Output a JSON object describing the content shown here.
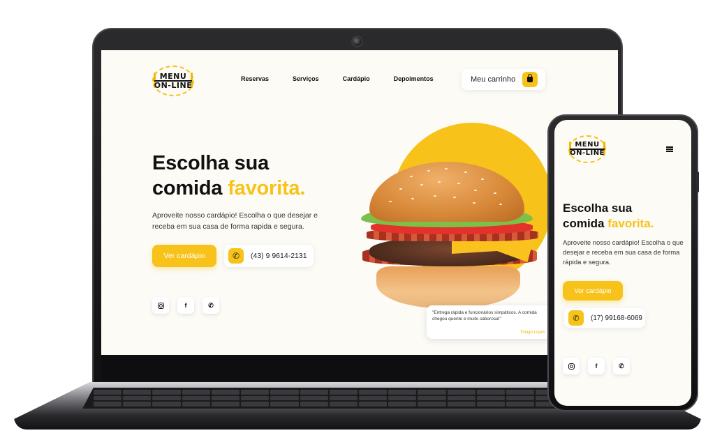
{
  "brand": {
    "line1": "MENU",
    "line2": "ON-LINE",
    "accent_color": "#f7c21a"
  },
  "desktop": {
    "nav": [
      "Reservas",
      "Serviços",
      "Cardápio",
      "Depoimentos"
    ],
    "cart_label": "Meu carrinho",
    "hero_title_line1": "Escolha sua",
    "hero_title_line2_plain": "comida",
    "hero_title_line2_accent": "favorita.",
    "hero_text": "Aproveite nosso cardápio! Escolha o que desejar e receba em sua casa de forma rapida e segura.",
    "cta_label": "Ver cardápio",
    "phone": "(43) 9 9614-2131",
    "socials": [
      "instagram-icon",
      "facebook-icon",
      "whatsapp-icon"
    ],
    "review": {
      "quote": "\"Entrega rápida e funcionários simpáticos. A comida chegou quente e muito saborosa!\"",
      "author": "Thiago Lopes"
    }
  },
  "mobile": {
    "hero_title_line1": "Escolha sua",
    "hero_title_line2_plain": "comida",
    "hero_title_line2_accent": "favorita.",
    "hero_text": "Aproveite nosso cardápio! Escolha o que desejar e receba em sua casa de forma rápida e segura.",
    "cta_label": "Ver cardápio",
    "phone": "(17) 99168-6069"
  }
}
